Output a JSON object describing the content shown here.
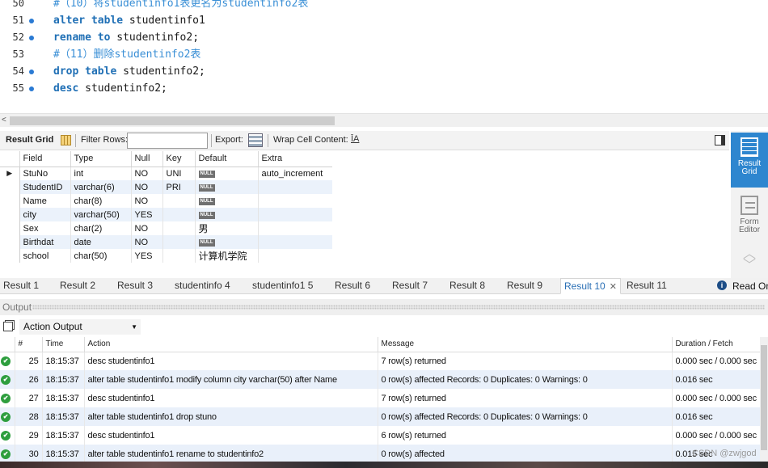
{
  "editor": {
    "lines": [
      {
        "num": "50",
        "segments": [
          {
            "text": "#（10）将studentinfo1表更名为studentinfo2表",
            "kind": "comment"
          }
        ]
      },
      {
        "num": "51",
        "segments": [
          {
            "text": "alter table",
            "kind": "keyword"
          },
          {
            "text": " studentinfo1",
            "kind": "plain"
          }
        ]
      },
      {
        "num": "52",
        "segments": [
          {
            "text": "rename to",
            "kind": "keyword"
          },
          {
            "text": " studentinfo2;",
            "kind": "plain"
          }
        ]
      },
      {
        "num": "53",
        "segments": [
          {
            "text": "#（11）删除studentinfo2表",
            "kind": "comment"
          }
        ]
      },
      {
        "num": "54",
        "segments": [
          {
            "text": "drop table",
            "kind": "keyword"
          },
          {
            "text": " studentinfo2;",
            "kind": "plain"
          }
        ]
      },
      {
        "num": "55",
        "segments": [
          {
            "text": "desc",
            "kind": "keyword"
          },
          {
            "text": " studentinfo2;",
            "kind": "plain"
          }
        ]
      }
    ]
  },
  "result_toolbar": {
    "result_grid_label": "Result Grid",
    "filter_rows_label": "Filter Rows:",
    "filter_rows_value": "",
    "export_label": "Export:",
    "wrap_cell_label": "Wrap Cell Content:",
    "wrap_icon_glyph": "ĪA"
  },
  "side_panel": {
    "result_grid_label": "Result\nGrid",
    "form_editor_label": "Form\nEditor"
  },
  "result_grid": {
    "null_badge": "NULL",
    "columns": [
      "Field",
      "Type",
      "Null",
      "Key",
      "Default",
      "Extra"
    ],
    "rows": [
      {
        "field": "StuNo",
        "type": "int",
        "null": "NO",
        "key": "UNI",
        "default": null,
        "extra": "auto_increment"
      },
      {
        "field": "StudentID",
        "type": "varchar(6)",
        "null": "NO",
        "key": "PRI",
        "default": null,
        "extra": ""
      },
      {
        "field": "Name",
        "type": "char(8)",
        "null": "NO",
        "key": "",
        "default": null,
        "extra": ""
      },
      {
        "field": "city",
        "type": "varchar(50)",
        "null": "YES",
        "key": "",
        "default": null,
        "extra": ""
      },
      {
        "field": "Sex",
        "type": "char(2)",
        "null": "NO",
        "key": "",
        "default": "男",
        "extra": ""
      },
      {
        "field": "Birthdat",
        "type": "date",
        "null": "NO",
        "key": "",
        "default": null,
        "extra": ""
      },
      {
        "field": "school",
        "type": "char(50)",
        "null": "YES",
        "key": "",
        "default": "计算机学院",
        "extra": ""
      }
    ]
  },
  "result_tabs": {
    "tabs": [
      "Result 1",
      "Result 2",
      "Result 3",
      "studentinfo 4",
      "studentinfo1 5",
      "Result 6",
      "Result 7",
      "Result 8",
      "Result 9",
      "Result 10",
      "Result 11"
    ],
    "active": "Result 10",
    "close_glyph": "✕",
    "read_only_label": "Read On"
  },
  "output": {
    "title": "Output",
    "selector_value": "Action Output",
    "columns": [
      "#",
      "Time",
      "Action",
      "Message",
      "Duration / Fetch"
    ],
    "rows": [
      {
        "num": "25",
        "time": "18:15:37",
        "action": "desc studentinfo1",
        "message": "7 row(s) returned",
        "duration": "0.000 sec / 0.000 sec"
      },
      {
        "num": "26",
        "time": "18:15:37",
        "action": "alter table studentinfo1 modify column city varchar(50) after Name",
        "message": "0 row(s) affected Records: 0  Duplicates: 0  Warnings: 0",
        "duration": "0.016 sec"
      },
      {
        "num": "27",
        "time": "18:15:37",
        "action": "desc studentinfo1",
        "message": "7 row(s) returned",
        "duration": "0.000 sec / 0.000 sec"
      },
      {
        "num": "28",
        "time": "18:15:37",
        "action": "alter table studentinfo1 drop stuno",
        "message": "0 row(s) affected Records: 0  Duplicates: 0  Warnings: 0",
        "duration": "0.016 sec"
      },
      {
        "num": "29",
        "time": "18:15:37",
        "action": "desc studentinfo1",
        "message": "6 row(s) returned",
        "duration": "0.000 sec / 0.000 sec"
      },
      {
        "num": "30",
        "time": "18:15:37",
        "action": "alter table studentinfo1 rename to studentinfo2",
        "message": "0 row(s) affected",
        "duration": "0.015 sec"
      }
    ]
  },
  "watermark": "CSDN @zwjgod"
}
